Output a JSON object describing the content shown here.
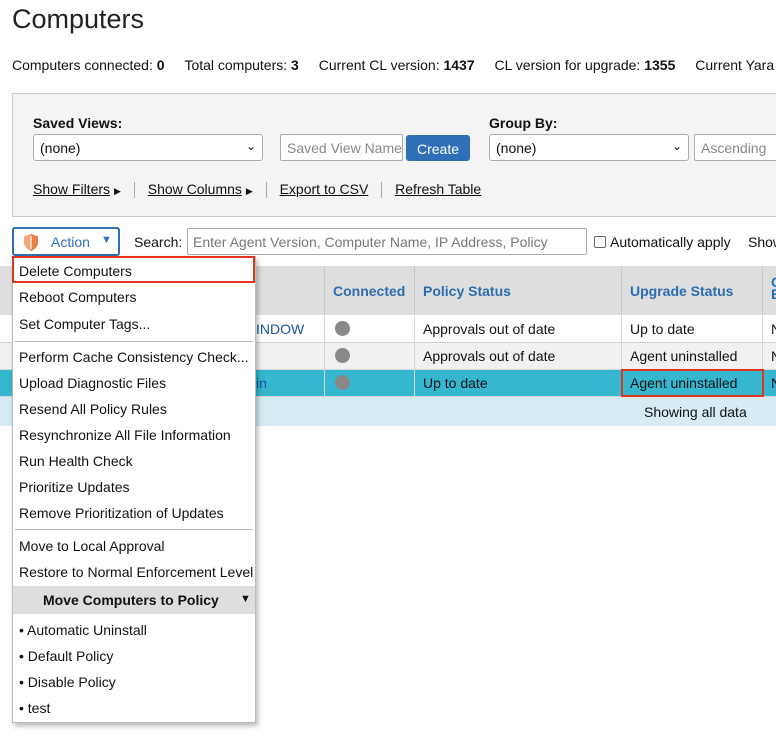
{
  "page": {
    "title": "Computers"
  },
  "stats": [
    {
      "label": "Computers connected:",
      "value": "0"
    },
    {
      "label": "Total computers:",
      "value": "3"
    },
    {
      "label": "Current CL version:",
      "value": "1437"
    },
    {
      "label": "CL version for upgrade:",
      "value": "1355"
    },
    {
      "label": "Current Yara",
      "value": ""
    }
  ],
  "filters": {
    "saved_views_label": "Saved Views:",
    "saved_views_value": "(none)",
    "saved_view_name_placeholder": "Saved View Name",
    "create_label": "Create",
    "group_by_label": "Group By:",
    "group_by_value": "(none)",
    "sort_order": "Ascending",
    "show_filters": "Show Filters",
    "show_columns": "Show Columns",
    "export_csv": "Export to CSV",
    "refresh_table": "Refresh Table"
  },
  "toolbar": {
    "action_label": "Action",
    "search_label": "Search:",
    "search_placeholder": "Enter Agent Version, Computer Name, IP Address, Policy",
    "auto_apply_label": "Automatically apply",
    "show_more": "Show"
  },
  "table": {
    "columns": [
      "Connected",
      "Policy Status",
      "Upgrade Status",
      "C",
      "E"
    ],
    "rows": [
      {
        "name_fragment": "INDOW",
        "policy_status": "Approvals out of date",
        "upgrade_status": "Up to date",
        "extra": "N"
      },
      {
        "name_fragment": "",
        "policy_status": "Approvals out of date",
        "upgrade_status": "Agent uninstalled",
        "extra": "N"
      },
      {
        "name_fragment": "in",
        "policy_status": "Up to date",
        "upgrade_status": "Agent uninstalled",
        "extra": "N"
      }
    ],
    "footer": "Showing all data"
  },
  "menu": {
    "group1": [
      "Delete Computers",
      "Reboot Computers",
      "Set Computer Tags..."
    ],
    "group2": [
      "Perform Cache Consistency Check...",
      "Upload Diagnostic Files",
      "Resend All Policy Rules",
      "Resynchronize All File Information",
      "Run Health Check",
      "Prioritize Updates",
      "Remove Prioritization of Updates"
    ],
    "group3": [
      "Move to Local Approval",
      "Restore to Normal Enforcement Level"
    ],
    "submenu_title": "Move Computers to Policy",
    "policies": [
      "• Automatic Uninstall",
      "• Default Policy",
      "• Disable Policy",
      "• test"
    ]
  },
  "colors": {
    "accent": "#2f6fb7",
    "selected_row": "#35b7cf",
    "highlight": "#e0341c"
  },
  "icons": {
    "action": "shield-icon",
    "dropdown": "chevron-down-icon"
  }
}
